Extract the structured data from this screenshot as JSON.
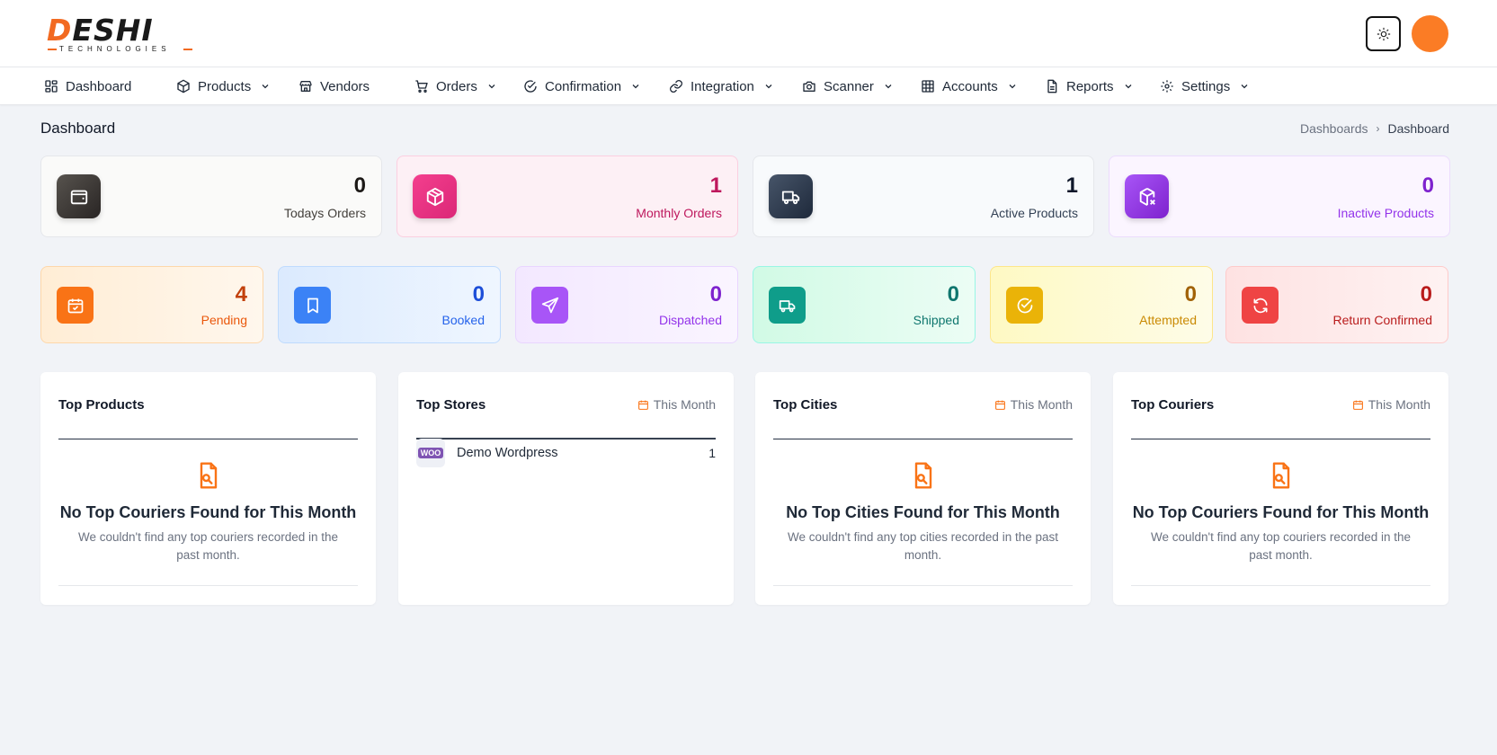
{
  "brand": {
    "name_part1": "D",
    "name_part2": "ESHI",
    "tagline": "TECHNOLOGIES"
  },
  "colors": {
    "accent": "#f26a21",
    "avatar": "#fb7c25"
  },
  "nav": [
    {
      "label": "Dashboard",
      "icon": "dashboard-icon",
      "chevron": false
    },
    {
      "label": "Products",
      "icon": "box-icon",
      "chevron": true
    },
    {
      "label": "Vendors",
      "icon": "store-icon",
      "chevron": false
    },
    {
      "label": "Orders",
      "icon": "cart-icon",
      "chevron": true
    },
    {
      "label": "Confirmation",
      "icon": "check-circle-icon",
      "chevron": true
    },
    {
      "label": "Integration",
      "icon": "link-icon",
      "chevron": true
    },
    {
      "label": "Scanner",
      "icon": "camera-icon",
      "chevron": true
    },
    {
      "label": "Accounts",
      "icon": "table-icon",
      "chevron": true
    },
    {
      "label": "Reports",
      "icon": "document-icon",
      "chevron": true
    },
    {
      "label": "Settings",
      "icon": "gear-icon",
      "chevron": true
    }
  ],
  "page": {
    "title": "Dashboard"
  },
  "breadcrumb": {
    "parent": "Dashboards",
    "current": "Dashboard"
  },
  "stats_top": [
    {
      "value": "0",
      "label": "Todays Orders",
      "icon": "wallet-icon"
    },
    {
      "value": "1",
      "label": "Monthly Orders",
      "icon": "box-icon"
    },
    {
      "value": "1",
      "label": "Active Products",
      "icon": "truck-icon"
    },
    {
      "value": "0",
      "label": "Inactive Products",
      "icon": "box-x-icon"
    }
  ],
  "stats_status": [
    {
      "value": "4",
      "label": "Pending",
      "icon": "calendar-check-icon"
    },
    {
      "value": "0",
      "label": "Booked",
      "icon": "bookmark-icon"
    },
    {
      "value": "0",
      "label": "Dispatched",
      "icon": "send-icon"
    },
    {
      "value": "0",
      "label": "Shipped",
      "icon": "truck-icon"
    },
    {
      "value": "0",
      "label": "Attempted",
      "icon": "check-circle-icon"
    },
    {
      "value": "0",
      "label": "Return Confirmed",
      "icon": "refresh-icon"
    }
  ],
  "panels": {
    "top_products": {
      "title": "Top Products",
      "empty_title": "No Top Couriers Found for This Month",
      "empty_desc": "We couldn't find any top couriers recorded in the past month."
    },
    "top_stores": {
      "title": "Top Stores",
      "filter": "This Month",
      "rows": [
        {
          "badge": "WOO",
          "name": "Demo Wordpress",
          "count": "1"
        }
      ]
    },
    "top_cities": {
      "title": "Top Cities",
      "filter": "This Month",
      "empty_title": "No Top Cities Found for This Month",
      "empty_desc": "We couldn't find any top cities recorded in the past month."
    },
    "top_couriers": {
      "title": "Top Couriers",
      "filter": "This Month",
      "empty_title": "No Top Couriers Found for This Month",
      "empty_desc": "We couldn't find any top couriers recorded in the past month."
    }
  }
}
